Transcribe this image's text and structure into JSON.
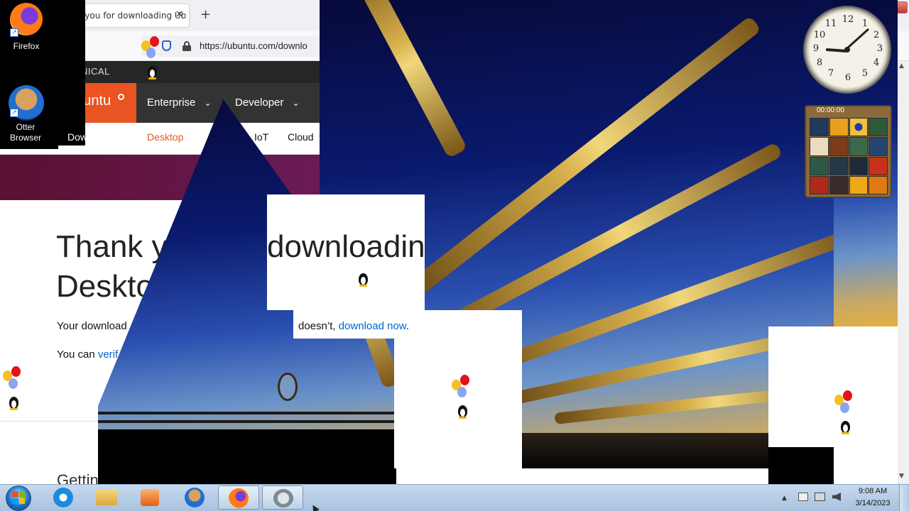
{
  "browser": {
    "tab_title": "hank you for downloading Ub",
    "tab_close": "✕",
    "new_tab": "+",
    "url": "https://ubuntu.com/downlo",
    "menu_icon": "≡",
    "window_controls": {
      "minimize": "–",
      "maximize": "▢",
      "close": "✕"
    }
  },
  "site": {
    "canonical_label": "NICAL",
    "logo_text": "ubuntu",
    "nav": {
      "enterprise": "Enterprise",
      "developer": "Developer",
      "chevron": "⌄"
    },
    "subnav": {
      "downloads": "Downloads",
      "desktop": "Desktop",
      "iot": "IoT",
      "cloud": "Cloud"
    },
    "page": {
      "title_line1": "Thank yo",
      "title_line1_end": "downloadin",
      "title_line2": "Deskto",
      "download_line_start": "Your download",
      "download_line_end": "doesn’t,",
      "download_link": "download now",
      "download_period": ".",
      "verify_prefix": "You can",
      "verify_link": "verif",
      "getting_started": "Getting sta"
    },
    "scroll_up": "▲",
    "scroll_down": "▼"
  },
  "desktop": {
    "icons": [
      {
        "label": "Firefox",
        "icon": "firefox-icon"
      },
      {
        "label": "Otter Browser",
        "icon": "otter-browser-icon"
      }
    ]
  },
  "gadgets": {
    "clock": {
      "numbers": [
        "12",
        "1",
        "2",
        "3",
        "4",
        "5",
        "6",
        "7",
        "8",
        "9",
        "10",
        "11"
      ],
      "hour": 9,
      "minute": 8
    },
    "puzzle": {
      "timer": "00:00:00"
    }
  },
  "taskbar": {
    "items": [
      {
        "icon": "internet-explorer-icon"
      },
      {
        "icon": "file-explorer-icon"
      },
      {
        "icon": "media-player-icon"
      },
      {
        "icon": "otter-browser-icon"
      },
      {
        "icon": "firefox-icon"
      },
      {
        "icon": "app-icon"
      }
    ],
    "tray": {
      "time": "9:08 AM",
      "date": "3/14/2023",
      "show_hidden": "▲"
    }
  },
  "colors": {
    "ubuntu_orange": "#e95420",
    "link_blue": "#0066cc",
    "canonical_bar": "#262626",
    "nav_bg": "#333333",
    "hero_purple": "#77216f"
  }
}
